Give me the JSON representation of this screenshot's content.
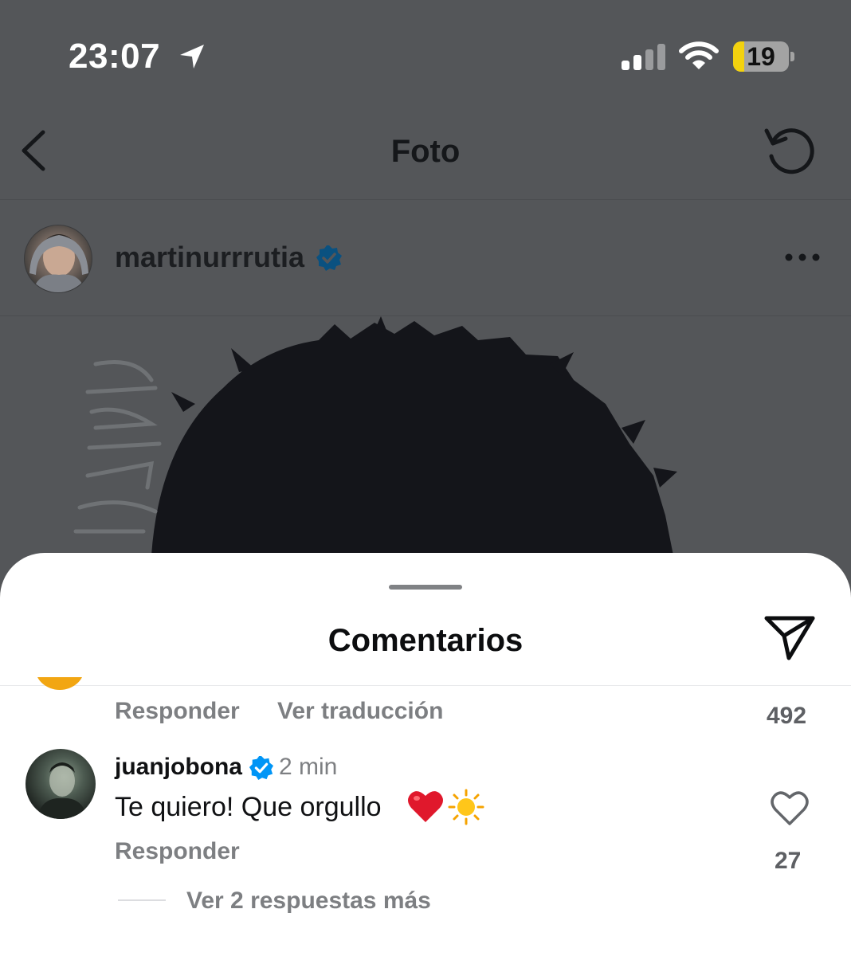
{
  "status_bar": {
    "time": "23:07",
    "battery": "19",
    "icons": [
      "location-arrow-icon",
      "cellular-signal-icon",
      "wifi-icon",
      "battery-icon"
    ]
  },
  "nav": {
    "title": "Foto",
    "back_icon": "chevron-left-icon",
    "refresh_icon": "refresh-icon"
  },
  "post": {
    "username": "martinurrrutia",
    "verified": true,
    "more_icon": "more-horizontal-icon"
  },
  "comments_sheet": {
    "title": "Comentarios",
    "share_icon": "send-icon",
    "previous_comment": {
      "reply_label": "Responder",
      "translate_label": "Ver traducción",
      "like_count": "492"
    },
    "comment": {
      "username": "juanjobona",
      "verified": true,
      "time": "2 min",
      "text": "Te quiero! Que orgullo",
      "emojis": [
        "red-heart-emoji",
        "sun-emoji"
      ],
      "reply_label": "Responder",
      "like_count": "27",
      "more_replies": "Ver 2 respuestas más"
    }
  },
  "colors": {
    "overlay_bg": "#545659",
    "sheet_bg": "#ffffff",
    "verified_blue": "#0095f6",
    "secondary_text": "#7d7f82"
  }
}
